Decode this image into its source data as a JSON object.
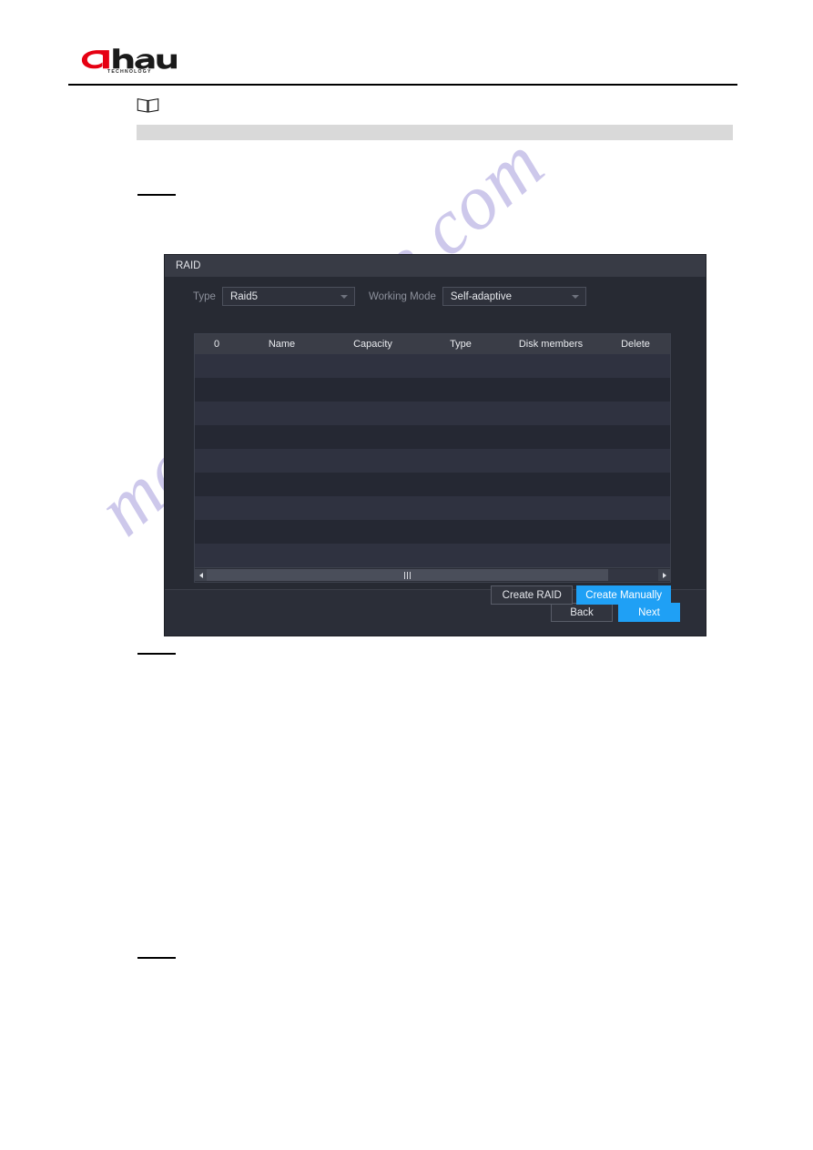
{
  "brand": {
    "logo_word": "hua",
    "logo_letter": "a",
    "tagline": "TECHNOLOGY"
  },
  "note_block": {
    "icon": "book-icon",
    "text": ""
  },
  "dialog": {
    "title": "RAID",
    "controls": {
      "type_label": "Type",
      "type_value": "Raid5",
      "type_options": [
        "Raid5"
      ],
      "mode_label": "Working Mode",
      "mode_value": "Self-adaptive",
      "mode_options": [
        "Self-adaptive"
      ]
    },
    "table": {
      "columns": [
        "0",
        "Name",
        "Capacity",
        "Type",
        "Disk members",
        "Delete"
      ],
      "rows": [],
      "empty_row_count": 9,
      "scrollbar": {
        "left_arrow": "◀",
        "right_arrow": "▶",
        "thumb_percent": 89
      }
    },
    "actions": {
      "create_raid": "Create RAID",
      "create_manually": "Create Manually"
    },
    "footer": {
      "back": "Back",
      "next": "Next"
    }
  },
  "watermark": {
    "text": "manualshive.com"
  },
  "colors": {
    "accent": "#1fa0f5",
    "brand_red": "#e60012",
    "dialog_bg": "#272a33",
    "titlebar_bg": "#383b45",
    "row_light": "#2f3240",
    "row_dark": "#252833",
    "note_bar": "#d9d9d9",
    "watermark": "#b0a8e0"
  }
}
